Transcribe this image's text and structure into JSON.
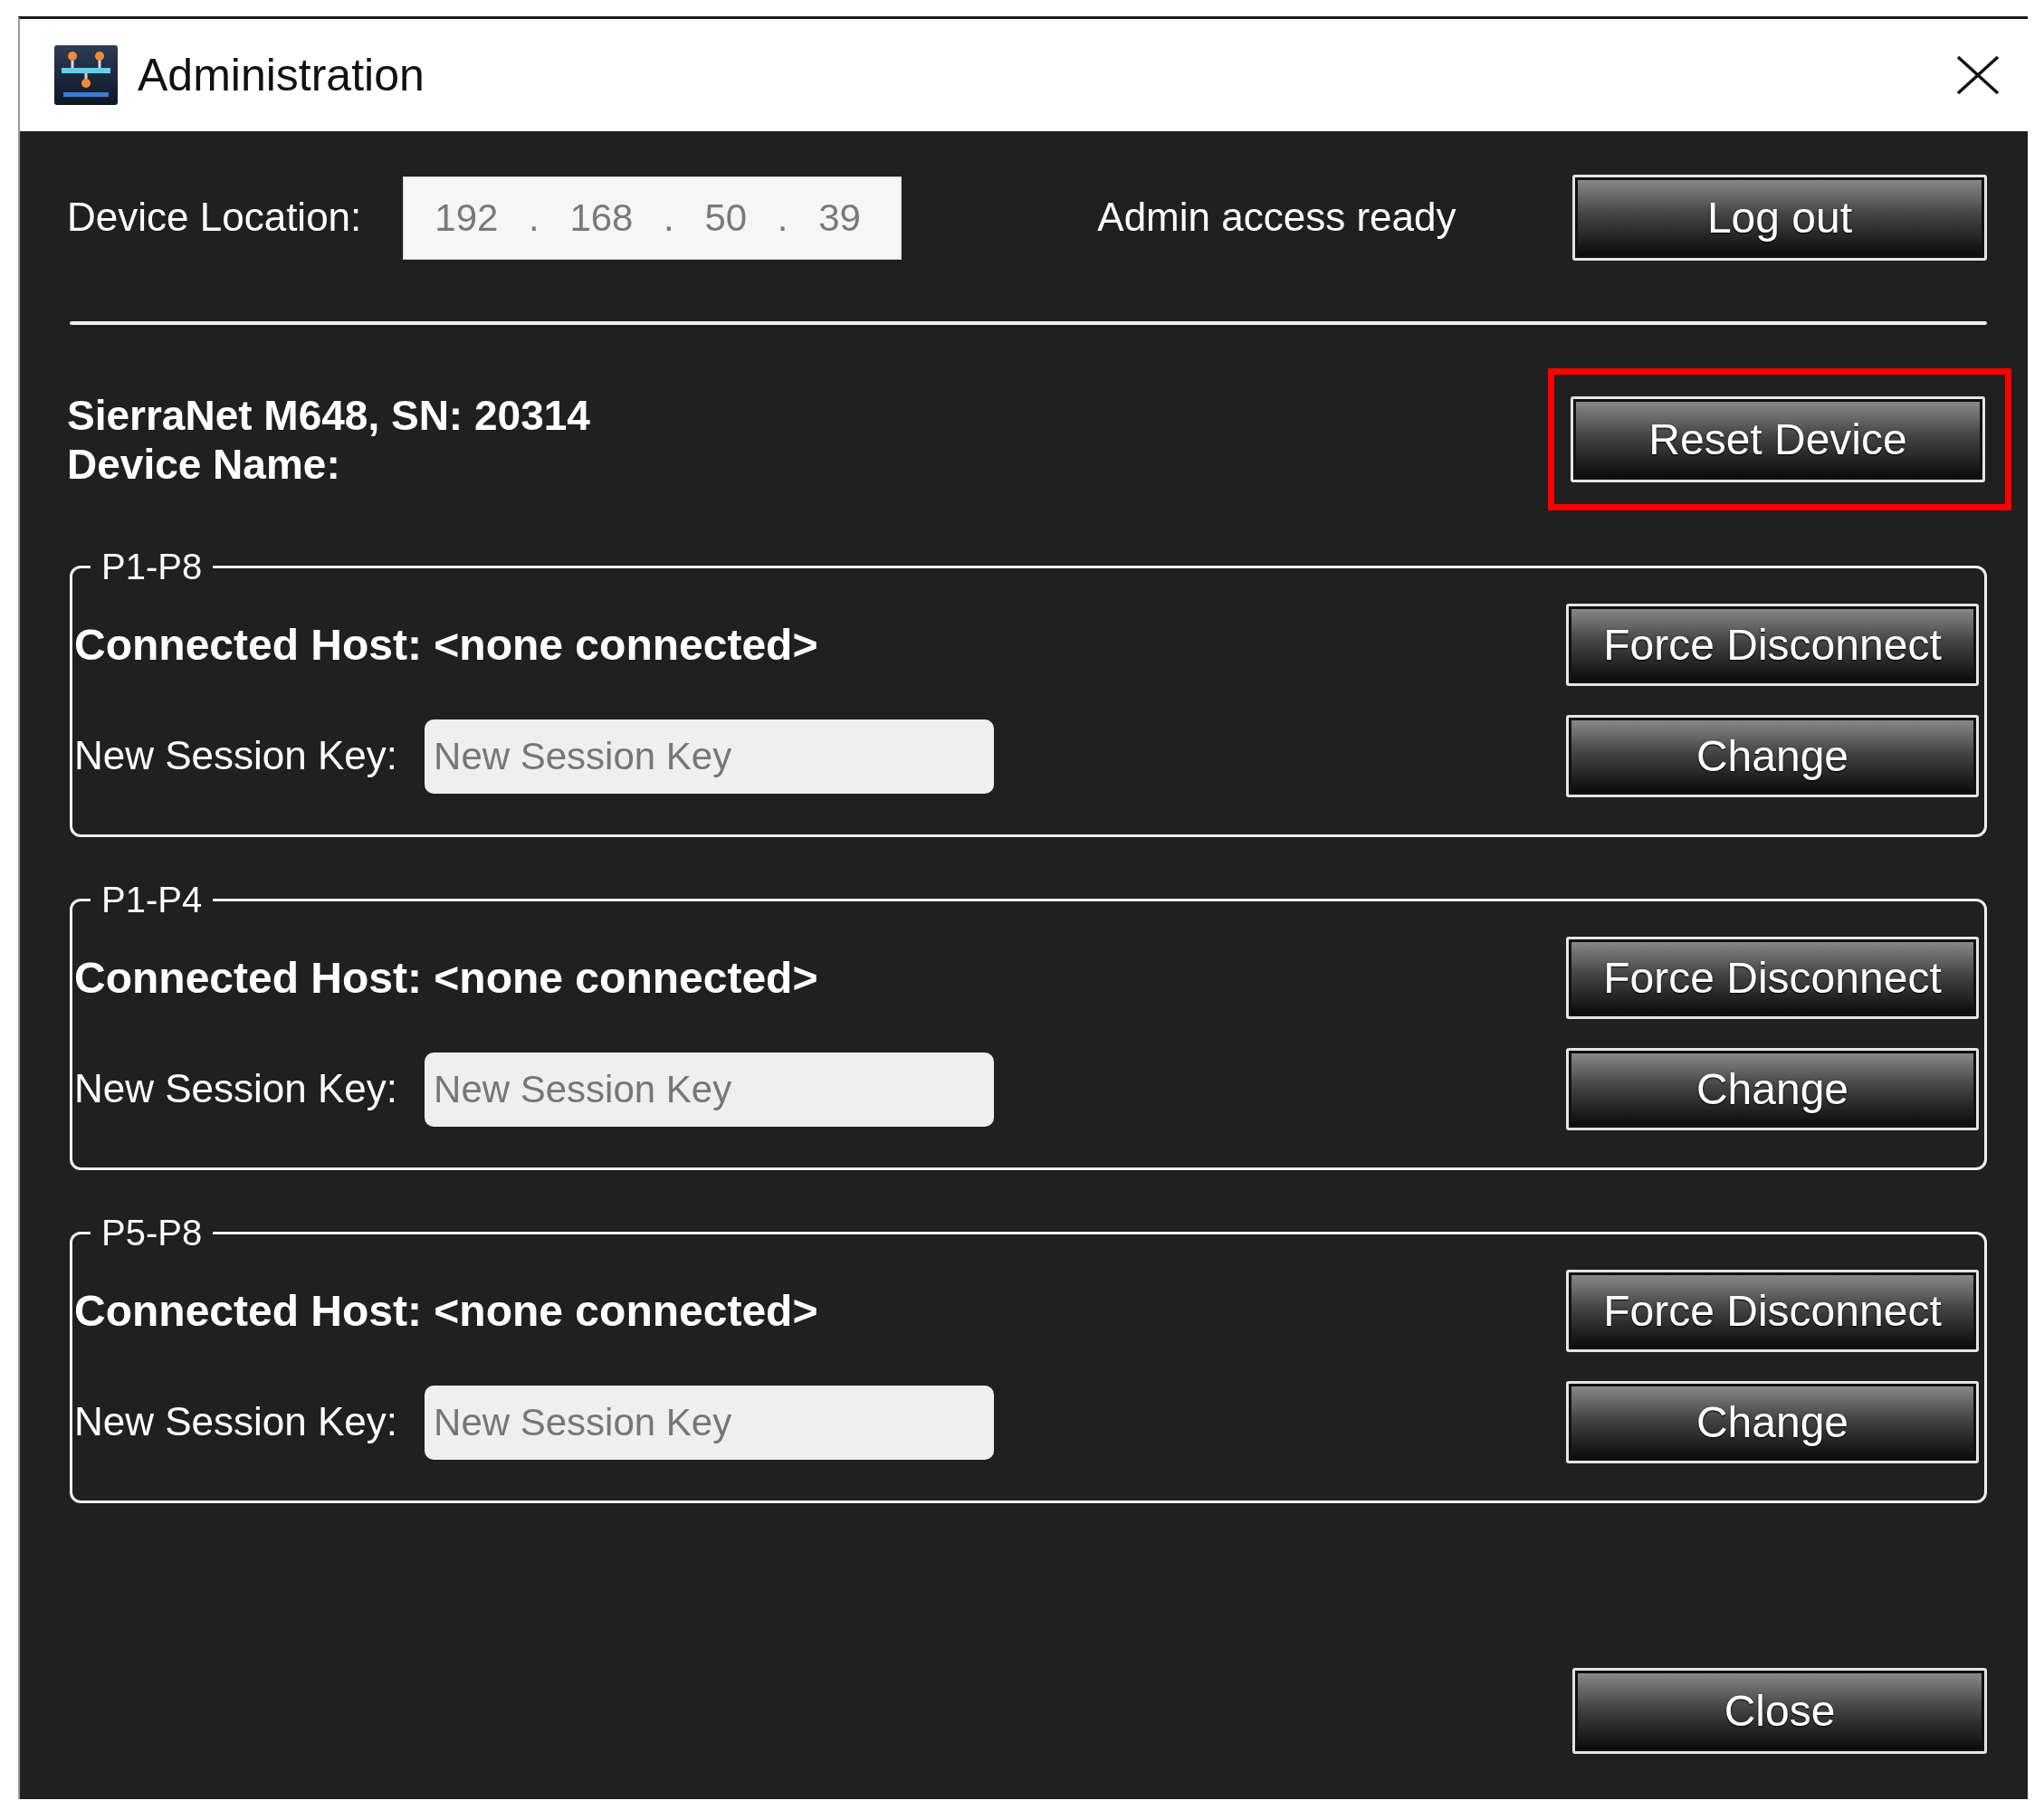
{
  "window": {
    "title": "Administration"
  },
  "device_location": {
    "label": "Device Location:",
    "value": "192 . 168 . 50 . 39"
  },
  "status": "Admin access ready",
  "logout_button": "Log out",
  "device": {
    "model_line": "SierraNet M648, SN: 20314",
    "name_label": "Device Name:",
    "reset_button": {
      "label": "Reset Device",
      "highlighted": true
    }
  },
  "port_groups": [
    {
      "title": "P1-P8",
      "connected_host": "Connected Host: <none connected>",
      "disconnect_button": "Force Disconnect",
      "session_key_label": "New Session Key:",
      "session_key": {
        "placeholder": "New Session Key"
      },
      "change_button": "Change"
    },
    {
      "title": "P1-P4",
      "connected_host": "Connected Host: <none connected>",
      "disconnect_button": "Force Disconnect",
      "session_key_label": "New Session Key:",
      "session_key": {
        "placeholder": "New Session Key"
      },
      "change_button": "Change"
    },
    {
      "title": "P5-P8",
      "connected_host": "Connected Host: <none connected>",
      "disconnect_button": "Force Disconnect",
      "session_key_label": "New Session Key:",
      "session_key": {
        "placeholder": "New Session Key"
      },
      "change_button": "Change"
    }
  ],
  "close_button": "Close"
}
